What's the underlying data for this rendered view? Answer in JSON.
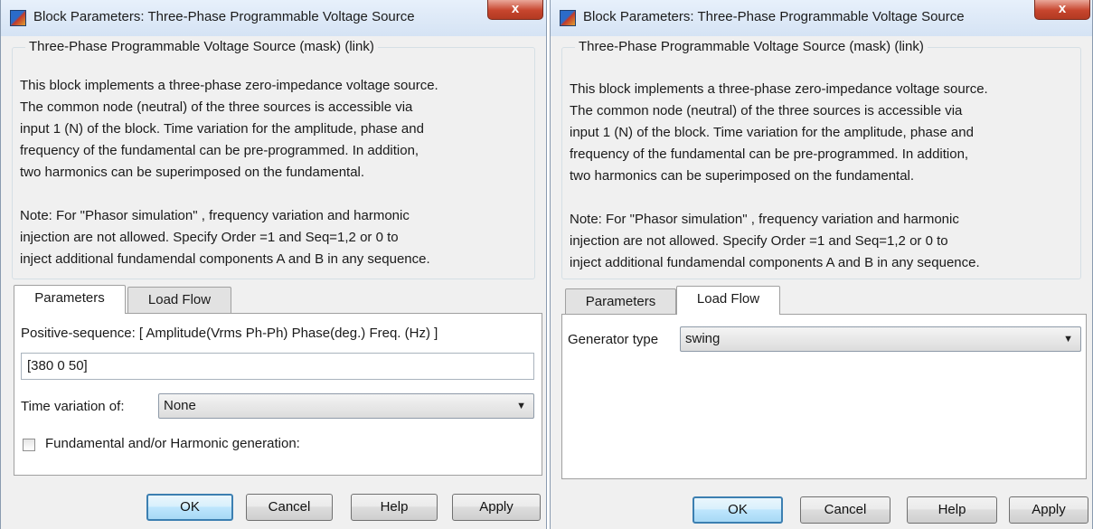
{
  "dialogs": [
    {
      "title": "Block Parameters: Three-Phase Programmable Voltage Source",
      "close_label": "x",
      "group_title": "Three-Phase Programmable Voltage Source (mask) (link)",
      "description": "This block implements a three-phase zero-impedance voltage source.\nThe common node (neutral) of the three sources is accessible via\ninput 1 (N) of the block. Time variation for the amplitude, phase and\nfrequency of the fundamental can be pre-programmed. In addition,\ntwo harmonics can be superimposed on the fundamental.\n\nNote: For  \"Phasor simulation\" , frequency variation and harmonic\ninjection are not allowed.  Specify  Order =1 and Seq=1,2 or 0 to\ninject additional fundamendal components A and B in  any sequence.",
      "tabs": [
        "Parameters",
        "Load Flow"
      ],
      "active_tab": "Parameters",
      "parameters": {
        "positive_sequence_label": "Positive-sequence: [ Amplitude(Vrms Ph-Ph)  Phase(deg.)  Freq. (Hz) ]",
        "positive_sequence_value": "[380  0 50]",
        "time_variation_label": "Time variation of:",
        "time_variation_value": "None",
        "harmonic_label": "Fundamental and/or Harmonic generation:",
        "harmonic_checked": false
      },
      "buttons": {
        "ok": "OK",
        "cancel": "Cancel",
        "help": "Help",
        "apply": "Apply"
      }
    },
    {
      "title": "Block Parameters: Three-Phase Programmable Voltage Source",
      "close_label": "x",
      "group_title": "Three-Phase Programmable Voltage Source (mask) (link)",
      "description": "This block implements a three-phase zero-impedance voltage source.\nThe common node (neutral) of the three sources is accessible via\ninput 1 (N) of the block. Time variation for the amplitude, phase and\nfrequency of the fundamental can be pre-programmed. In addition,\ntwo harmonics can be superimposed on the fundamental.\n\nNote: For  \"Phasor simulation\" , frequency variation and harmonic\ninjection are not allowed.  Specify  Order =1 and Seq=1,2 or 0 to\ninject additional fundamendal components A and B in  any sequence.",
      "tabs": [
        "Parameters",
        "Load Flow"
      ],
      "active_tab": "Load Flow",
      "load_flow": {
        "generator_type_label": "Generator type",
        "generator_type_value": "swing"
      },
      "buttons": {
        "ok": "OK",
        "cancel": "Cancel",
        "help": "Help",
        "apply": "Apply"
      }
    }
  ],
  "icons": {
    "app": "simulink-block-icon",
    "dropdown": "chevron-down-icon"
  }
}
